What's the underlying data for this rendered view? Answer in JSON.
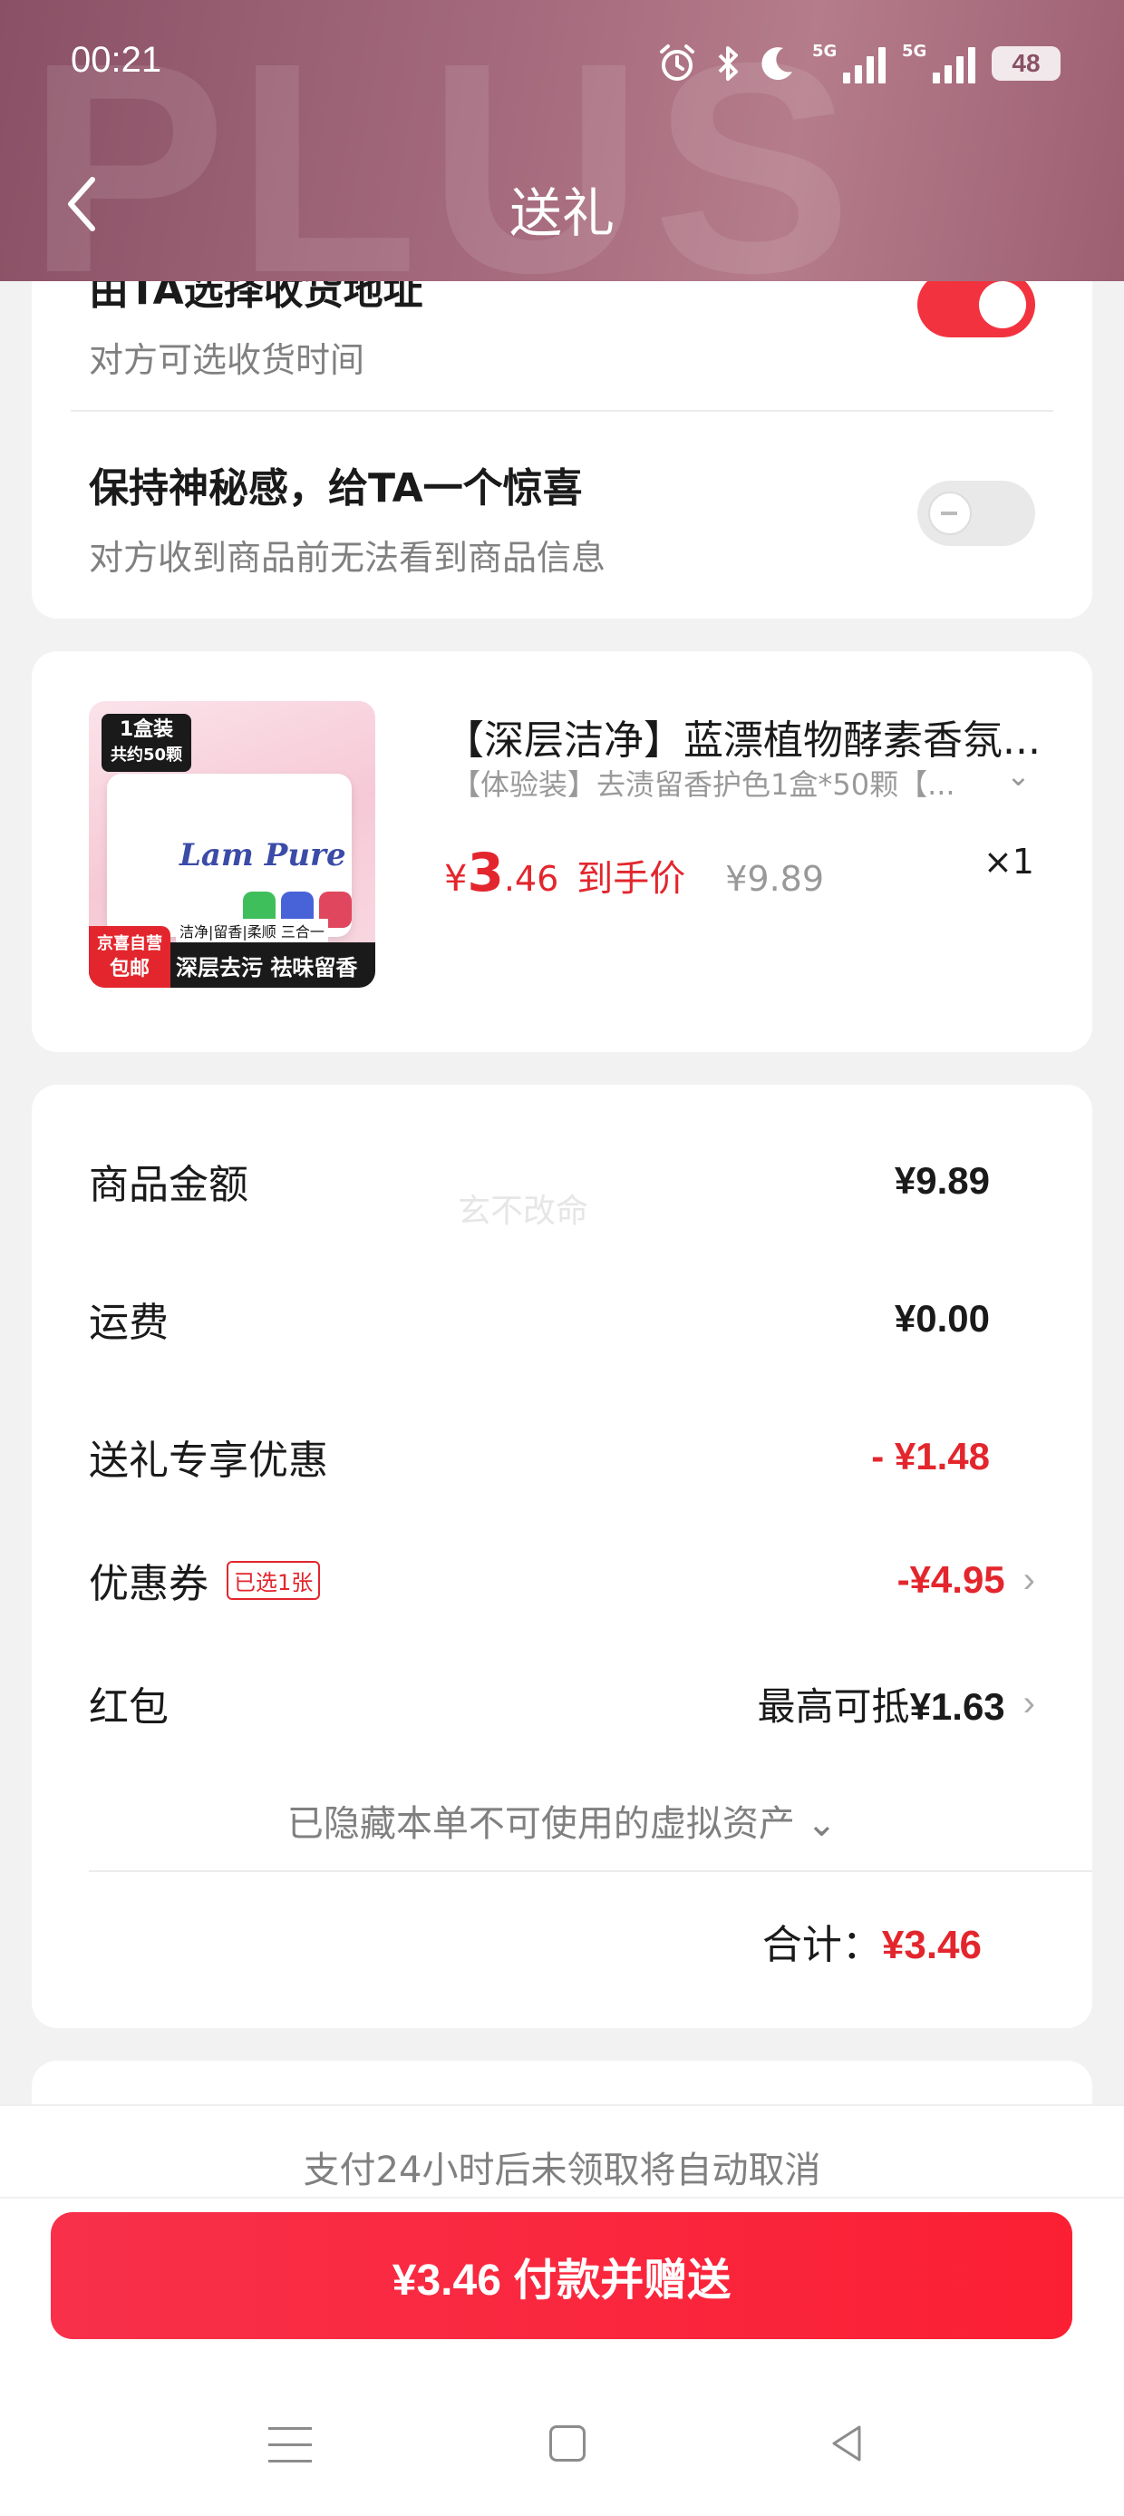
{
  "status_bar": {
    "time": "00:21",
    "icons": [
      "alarm-icon",
      "bluetooth-icon",
      "moon-icon",
      "5g-signal-icon",
      "5g-signal-icon",
      "battery-icon"
    ],
    "signal_label_1": "5G",
    "signal_label_2": "5G",
    "battery": "48"
  },
  "header": {
    "title": "送礼",
    "watermark": "PLUS",
    "back_icon": "chevron-left-icon"
  },
  "options": {
    "partial_title": "由TA选择收货地址",
    "partial_subtitle": "对方可选收货时间",
    "partial_toggle_on": true,
    "mystery_title": "保持神秘感，给TA一个惊喜",
    "mystery_subtitle": "对方收到商品前无法看到商品信息",
    "mystery_toggle_on": false
  },
  "product": {
    "image_badge_line1": "1盒装",
    "image_badge_line2": "共约50颗",
    "image_brand": "Lam Pure",
    "image_tag_line1": "京喜自营",
    "image_tag_line2": "包邮",
    "image_strip": "洁净|留香|柔顺 三合一",
    "image_bottom": "深层去污 祛味留香",
    "title": "【深层洁净】蓝漂植物酵素香氛...",
    "spec": "【体验装】去渍留香护色1盒*50颗【...",
    "price_yen": "¥",
    "price_int": "3",
    "price_dec": ".46",
    "price_label": "到手价",
    "original_price": "¥9.89",
    "quantity": "×1"
  },
  "summary": {
    "watermark": "玄不改命",
    "rows": [
      {
        "label": "商品金额",
        "value": "¥9.89"
      },
      {
        "label": "运费",
        "value": "¥0.00"
      },
      {
        "label": "送礼专享优惠",
        "value": "- ¥1.48"
      },
      {
        "label": "优惠券",
        "tag": "已选1张",
        "value": "-¥4.95"
      },
      {
        "label": "红包",
        "value_prefix": "最高可抵",
        "value": "¥1.63"
      }
    ],
    "hidden_assets": "已隐藏本单不可使用的虚拟资产 ⌄",
    "total_label": "合计：",
    "total_value": "¥3.46"
  },
  "footer": {
    "notice": "支付24小时后未领取将自动取消",
    "pay_button": "¥3.46 付款并赠送"
  },
  "colors": {
    "accent": "#e3262d",
    "header_bg": "#9c5f72",
    "pay_button": "#fb1f33"
  }
}
